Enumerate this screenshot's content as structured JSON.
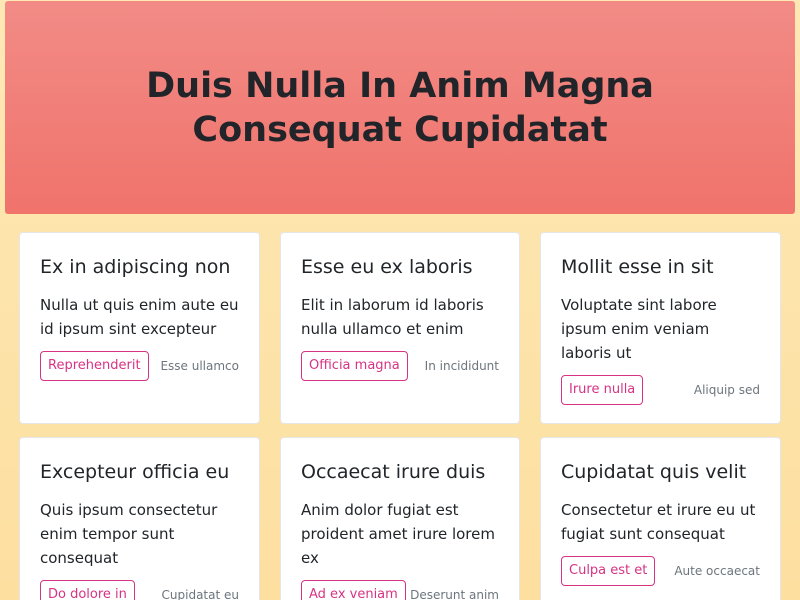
{
  "hero": {
    "title": "Duis Nulla In Anim Magna Consequat Cupidatat"
  },
  "cards": [
    {
      "title": "Ex in adipiscing non",
      "text": "Nulla ut quis enim aute eu id ipsum sint excepteur",
      "button": "Reprehenderit",
      "meta": "Esse ullamco"
    },
    {
      "title": "Esse eu ex laboris",
      "text": "Elit in laborum id laboris nulla ullamco et enim",
      "button": "Officia magna",
      "meta": "In incididunt"
    },
    {
      "title": "Mollit esse in sit",
      "text": "Voluptate sint labore ipsum enim veniam laboris ut",
      "button": "Irure nulla",
      "meta": "Aliquip sed"
    },
    {
      "title": "Excepteur officia eu",
      "text": "Quis ipsum consectetur enim tempor sunt consequat",
      "button": "Do dolore in",
      "meta": "Cupidatat eu"
    },
    {
      "title": "Occaecat irure duis",
      "text": "Anim dolor fugiat est proident amet irure lorem ex",
      "button": "Ad ex veniam",
      "meta": "Deserunt anim"
    },
    {
      "title": "Cupidatat quis velit",
      "text": "Consectetur et irure eu ut fugiat sunt consequat",
      "button": "Culpa est et",
      "meta": "Aute occaecat"
    }
  ],
  "colors": {
    "background": "#fde8b5",
    "hero": "#f0736c",
    "accent": "#d63384",
    "text": "#212529",
    "muted": "#6c757d"
  }
}
